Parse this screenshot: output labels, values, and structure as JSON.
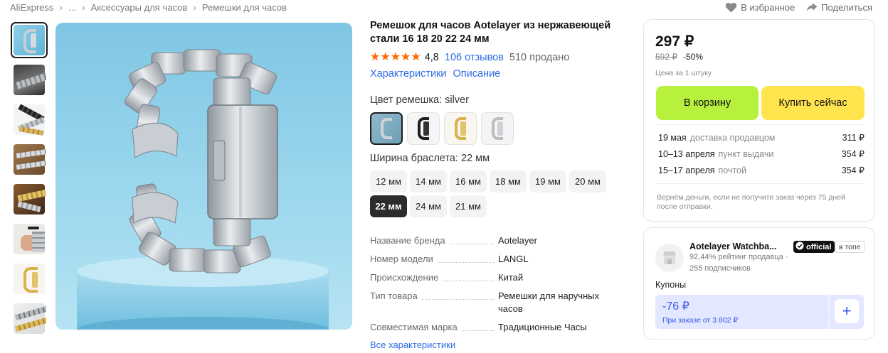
{
  "breadcrumb": {
    "items": [
      "AliExpress",
      "...",
      "Аксессуары для часов",
      "Ремешки для часов"
    ]
  },
  "top_actions": {
    "favorite": "В избранное",
    "share": "Поделиться"
  },
  "product": {
    "title": "Ремешок для часов Aotelayer из нержавеющей стали 16 18 20 22 24 мм",
    "rating": "4,8",
    "reviews": "106 отзывов",
    "sold": "510 продано",
    "tab_specs": "Характеристики",
    "tab_description": "Описание",
    "color_label": "Цвет ремешка: silver",
    "colors": [
      "silver",
      "black",
      "gold",
      "silver-gold"
    ],
    "width_label": "Ширина браслета: 22 мм",
    "sizes": [
      "12 мм",
      "14 мм",
      "16 мм",
      "18 мм",
      "19 мм",
      "20 мм",
      "22 мм",
      "24 мм",
      "21 мм"
    ],
    "selected_size": "22 мм"
  },
  "specs": [
    {
      "key": "Название бренда",
      "value": "Aotelayer"
    },
    {
      "key": "Номер модели",
      "value": "LANGL"
    },
    {
      "key": "Происхождение",
      "value": "Китай"
    },
    {
      "key": "Тип товара",
      "value": "Ремешки для наручных часов"
    },
    {
      "key": "Совместимая марка",
      "value": "Традиционные Часы"
    }
  ],
  "all_specs_link": "Все характеристики",
  "buy": {
    "price": "297 ₽",
    "old_price": "592 ₽",
    "discount": "-50%",
    "per_unit": "Цена за 1 штуку",
    "cart_button": "В корзину",
    "buy_button": "Купить сейчас",
    "deliveries": [
      {
        "date": "19 мая",
        "type": "доставка продавцом",
        "price": "311 ₽"
      },
      {
        "date": "10–13 апреля",
        "type": "пункт выдачи",
        "price": "354 ₽"
      },
      {
        "date": "15–17 апреля",
        "type": "почтой",
        "price": "354 ₽"
      }
    ],
    "refund_note": "Вернём деньги, если не получите заказ через 75 дней после отправки."
  },
  "seller": {
    "name": "Aotelayer Watchba...",
    "badge_official": "official",
    "badge_top": "в топе",
    "rating": "92,44% рейтинг продавца ·",
    "subscribers": "255 подписчиков",
    "coupons_label": "Купоны",
    "coupon_amount": "-76 ₽",
    "coupon_condition": "При заказе от 3 802 ₽",
    "coupon_add": "+"
  },
  "colors": {
    "accent_link": "#2e6be6",
    "star": "#ff6a00",
    "cart_button": "#b8f03e",
    "buy_button": "#ffe44d",
    "coupon_bg": "#e3e7ff",
    "coupon_text": "#3658e8"
  },
  "icons": [
    "chevron-right-icon",
    "heart-icon",
    "share-icon",
    "star-icon",
    "store-icon",
    "verified-icon",
    "plus-icon"
  ]
}
